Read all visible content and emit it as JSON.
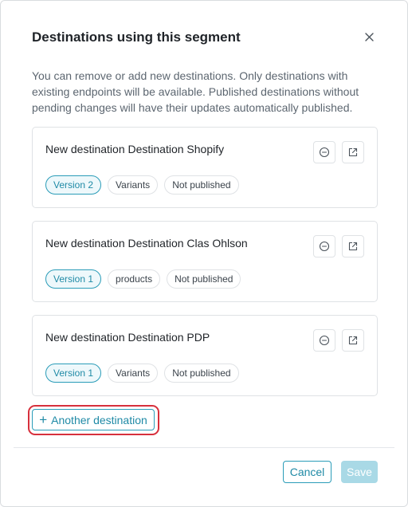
{
  "modal": {
    "title": "Destinations using this segment",
    "description": "You can remove or add new destinations. Only destinations with existing endpoints will be available. Published destinations without pending changes will have their updates automatically published."
  },
  "destinations": [
    {
      "name": "New destination Destination Shopify",
      "version": "Version 2",
      "type": "Variants",
      "status": "Not published"
    },
    {
      "name": "New destination Destination Clas Ohlson",
      "version": "Version 1",
      "type": "products",
      "status": "Not published"
    },
    {
      "name": "New destination Destination PDP",
      "version": "Version 1",
      "type": "Variants",
      "status": "Not published"
    }
  ],
  "add_button": {
    "plus": "+",
    "label": "Another destination"
  },
  "footer": {
    "cancel_label": "Cancel",
    "save_label": "Save"
  },
  "colors": {
    "accent": "#2a9cb8",
    "highlight": "#d7303c",
    "save_disabled": "#a9d9e6"
  },
  "icons": {
    "close": "close-icon",
    "remove": "minus-circle-icon",
    "open": "external-link-icon"
  }
}
